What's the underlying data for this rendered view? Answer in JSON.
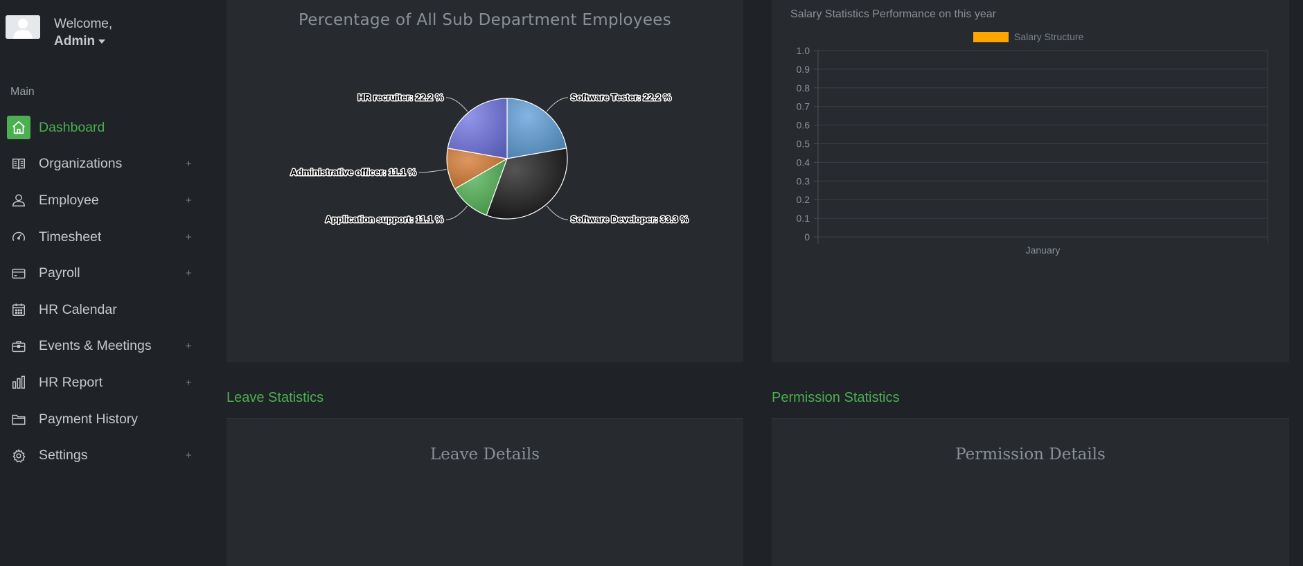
{
  "user": {
    "welcome": "Welcome,",
    "name": "Admin"
  },
  "sidebar": {
    "section": "Main",
    "items": [
      {
        "label": "Dashboard",
        "icon": "home-icon",
        "active": true,
        "expandable": false
      },
      {
        "label": "Organizations",
        "icon": "book-icon",
        "expandable": true
      },
      {
        "label": "Employee",
        "icon": "user-icon",
        "expandable": true
      },
      {
        "label": "Timesheet",
        "icon": "speedometer-icon",
        "expandable": true
      },
      {
        "label": "Payroll",
        "icon": "credit-card-icon",
        "expandable": true
      },
      {
        "label": "HR Calendar",
        "icon": "calendar-icon",
        "expandable": false
      },
      {
        "label": "Events & Meetings",
        "icon": "briefcase-icon",
        "expandable": true
      },
      {
        "label": "HR Report",
        "icon": "bar-chart-icon",
        "expandable": true
      },
      {
        "label": "Payment History",
        "icon": "folder-icon",
        "expandable": false
      },
      {
        "label": "Settings",
        "icon": "gear-icon",
        "expandable": true
      }
    ],
    "expand_symbol": "+",
    "accent": "#4caf50"
  },
  "pie_panel": {
    "title": "Percentage of All Sub Department Employees"
  },
  "bar_panel": {
    "title": "Salary Statistics Performance on this year"
  },
  "leave": {
    "heading": "Leave Statistics",
    "title": "Leave Details"
  },
  "permission": {
    "heading": "Permission Statistics",
    "title": "Permission Details"
  },
  "chart_data": [
    {
      "type": "pie",
      "title": "Percentage of All Sub Department Employees",
      "slices": [
        {
          "label": "Software Tester: 22.2 %",
          "value": 22.2,
          "color": "#5b9bd5"
        },
        {
          "label": "Software Developer: 33.3 %",
          "value": 33.3,
          "color": "#111111"
        },
        {
          "label": "Application support: 11.1 %",
          "value": 11.1,
          "color": "#4caf50"
        },
        {
          "label": "Administrative officer: 11.1 %",
          "value": 11.1,
          "color": "#d2762c"
        },
        {
          "label": "HR recruiter: 22.2 %",
          "value": 22.2,
          "color": "#6e72e0"
        }
      ]
    },
    {
      "type": "bar",
      "title": "Salary Statistics Performance on this year",
      "categories": [
        "January"
      ],
      "series": [
        {
          "name": "Salary Structure",
          "values": [
            0
          ],
          "color": "#ffa500"
        }
      ],
      "ylim": [
        0,
        1.0
      ],
      "yticks": [
        "0",
        "0.1",
        "0.2",
        "0.3",
        "0.4",
        "0.5",
        "0.6",
        "0.7",
        "0.8",
        "0.9",
        "1.0"
      ],
      "grid": true,
      "legend": "top"
    }
  ]
}
